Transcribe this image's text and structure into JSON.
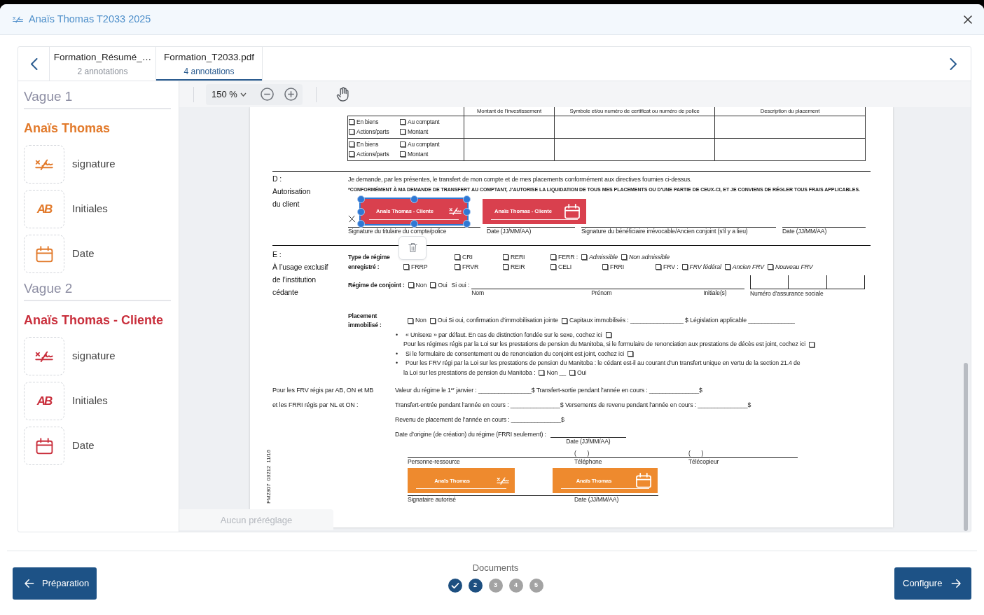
{
  "dialog": {
    "title": "Anaïs Thomas T2033 2025"
  },
  "document_tabs": [
    {
      "name": "Formation_Résumé_…",
      "count": "2 annotations",
      "selected": false
    },
    {
      "name": "Formation_T2033.pdf",
      "count": "4 annotations",
      "selected": true
    }
  ],
  "sidebar": {
    "waves": [
      {
        "title": "Vague 1",
        "signers": [
          {
            "name": "Anaïs Thomas",
            "color": "#e27a2b",
            "fields": [
              {
                "kind": "signature",
                "label": "signature"
              },
              {
                "kind": "initials",
                "glyph": "AB",
                "label": "Initiales"
              },
              {
                "kind": "date",
                "label": "Date"
              }
            ]
          }
        ]
      },
      {
        "title": "Vague 2",
        "signers": [
          {
            "name": "Anaïs Thomas - Cliente",
            "color": "#c92f3c",
            "fields": [
              {
                "kind": "signature",
                "label": "signature"
              },
              {
                "kind": "initials",
                "glyph": "AB",
                "label": "Initiales"
              },
              {
                "kind": "date",
                "label": "Date"
              }
            ]
          }
        ]
      }
    ]
  },
  "viewer": {
    "zoom": "150 %",
    "preset": {
      "placeholder": "Aucun préréglage"
    }
  },
  "document": {
    "table": {
      "columns": [
        "Montant de l’investissement",
        "Symbole et/ou numéro de certificat ou numéro de police",
        "Description du placement"
      ],
      "rows": [
        {
          "choices": [
            {
              "label": "En biens",
              "checked": false
            },
            {
              "label": "Au comptant",
              "checked": false
            },
            {
              "label": "Actions/parts",
              "checked": false
            },
            {
              "label": "Montant",
              "checked": false
            }
          ]
        },
        {
          "choices": [
            {
              "label": "En biens",
              "checked": false
            },
            {
              "label": "Au comptant",
              "checked": false
            },
            {
              "label": "Actions/parts",
              "checked": false
            },
            {
              "label": "Montant",
              "checked": false
            }
          ]
        }
      ]
    },
    "section_d": {
      "letter": "D :",
      "title_lines": [
        "Autorisation",
        "du client"
      ],
      "statement": "Je demande, par les présentes, le transfert de mon compte et de mes placements conformément aux directives fournies ci-dessus.",
      "notice": "*CONFORMÉMENT À MA DEMANDE DE TRANSFERT AU COMPTANT, J’AUTORISE LA LIQUIDATION DE TOUS MES PLACEMENTS OU D’UNE PARTIE DE CEUX-CI, ET JE CONVIENS DE RÉGLER TOUS FRAIS APPLICABLES.",
      "annotations": [
        {
          "signer": "Anaïs Thomas - Cliente",
          "kind": "signature",
          "color": "#d9404e",
          "selected": true
        },
        {
          "signer": "Anaïs Thomas - Cliente",
          "kind": "date",
          "color": "#d9404e",
          "selected": false
        }
      ],
      "signature_lines": [
        "Signature du titulaire du compte/police",
        "Date (JJ/MM/AA)",
        "Signature du bénéficiaire irrévocable/Ancien conjoint (s’il y a lieu)",
        "Date (JJ/MM/AA)"
      ]
    },
    "section_e": {
      "letter": "E :",
      "title_lines": [
        "À l’usage exclusif",
        "de l’institution",
        "cédante"
      ],
      "regime": {
        "label_lines": [
          "Type de régime",
          "enregistré :"
        ],
        "rows": [
          [
            "",
            [
              {
                "text": "CRI",
                "checked": false
              }
            ],
            [
              {
                "text": "RERI",
                "checked": false
              }
            ],
            [
              {
                "text": "FERR :",
                "checked": false
              },
              {
                "text": "Admissible",
                "italic": true,
                "checked": false
              },
              {
                "text": "Non admissible",
                "italic": true,
                "checked": false
              }
            ]
          ],
          [
            [
              {
                "text": "FRRP",
                "checked": false
              }
            ],
            [
              {
                "text": "FRVR",
                "checked": false
              }
            ],
            [
              {
                "text": "REIR",
                "checked": false
              }
            ],
            [
              {
                "text": "CELI",
                "checked": false
              }
            ],
            [
              {
                "text": "FRRI",
                "checked": false
              }
            ],
            [
              {
                "text": "FRV :",
                "checked": false
              },
              {
                "text": "FRV fédéral",
                "italic": true,
                "checked": false
              },
              {
                "text": "Ancien FRV",
                "italic": true,
                "checked": false
              },
              {
                "text": "Nouveau FRV",
                "italic": true,
                "checked": false
              }
            ]
          ]
        ]
      },
      "spouse": {
        "label": "Régime de conjoint :",
        "options": [
          {
            "label": "Non",
            "checked": false
          },
          {
            "label": "Oui",
            "checked": false
          }
        ],
        "if_yes": "Si oui :",
        "name_captions": [
          "Nom",
          "Prénom",
          "Initiale(s)"
        ],
        "sin_caption": "Numéro d’assurance sociale"
      },
      "locked_in": {
        "label_lines": [
          "Placement",
          "immobilisé :"
        ],
        "runs": [
          {
            "kind": "box",
            "checked": false
          },
          {
            "kind": "text",
            "text": "Non"
          },
          {
            "kind": "box",
            "checked": false
          },
          {
            "kind": "text",
            "text": "Oui Si oui, confirmation d’immobilisation jointe"
          },
          {
            "kind": "box",
            "checked": false
          },
          {
            "kind": "text",
            "text": "Capitaux immobilisés : ________________ $ Législation applicable ______________"
          }
        ]
      },
      "notes": [
        {
          "bullet": "•",
          "runs": [
            {
              "kind": "text",
              "text": "« Unisexe » par défaut. En cas de distinction fondée sur le sexe, cochez ici"
            },
            {
              "kind": "box",
              "checked": false
            }
          ]
        },
        {
          "runs": [
            {
              "kind": "text",
              "text": "Pour les régimes régis par la Loi sur les prestations de pension du Manitoba, si le formulaire de renonciation aux prestations de décès est joint, cochez ici"
            },
            {
              "kind": "box",
              "checked": false
            }
          ]
        },
        {
          "bullet": "•",
          "runs": [
            {
              "kind": "text",
              "text": "Si le formulaire de consentement ou de renonciation du conjoint est joint, cochez ici"
            },
            {
              "kind": "box",
              "checked": false
            }
          ]
        },
        {
          "bullet": "•",
          "runs": [
            {
              "kind": "text",
              "text": "Pour les FRV régi par la Loi sur les prestations de pension du Manitoba : le cédant est-il au courant d’un transfert unique en vertu de la section 21.4 de"
            }
          ]
        },
        {
          "runs": [
            {
              "kind": "text",
              "text": "la Loi sur les prestations de pension du Manitoba :"
            },
            {
              "kind": "box",
              "checked": false
            },
            {
              "kind": "text",
              "text": "Non __"
            },
            {
              "kind": "box",
              "checked": false
            },
            {
              "kind": "text",
              "text": "Oui"
            }
          ]
        }
      ]
    },
    "balances": {
      "label_lines": [
        "Pour les FRV régis par AB, ON et MB",
        "et les FRRI régis par NL et ON :"
      ],
      "lines": [
        "Valeur du régime le 1$^{er}$ janvier : ________________$ Transfert-sortie pendant l’année en cours : _______________$",
        "Transfert-entrée pendant l’année en cours : _______________$ Versements de revenu pendant l’année en cours : _______________$",
        "Revenu de placement de l’année en cours : _______________$"
      ],
      "origin": {
        "text": "Date d’origine (de création) du régime (FRRI seulement) :",
        "caption": "Date (JJ/MM/AA)"
      }
    },
    "contact": {
      "top_fields": [
        {
          "label": "Personne-ressource"
        },
        {
          "prefix": "(       )",
          "label": "Téléphone"
        },
        {
          "prefix": "(       )",
          "label": "Télécopieur"
        }
      ],
      "annotations": [
        {
          "signer": "Anaïs Thomas",
          "kind": "signature",
          "color": "#ee8a2e",
          "selected": false
        },
        {
          "signer": "Anaïs Thomas",
          "kind": "date",
          "color": "#ee8a2e",
          "selected": false
        }
      ],
      "bottom_fields": [
        {
          "label": "Signataire autorisé"
        },
        {
          "label": "Date (JJ/MM/AA)"
        }
      ]
    },
    "form_code": "FM2307  03212  11/16"
  },
  "footer": {
    "back": "Préparation",
    "label": "Documents",
    "steps": [
      {
        "completed": true,
        "current": false
      },
      {
        "label": "2",
        "completed": false,
        "current": true
      },
      {
        "label": "3",
        "completed": false,
        "current": false
      },
      {
        "label": "4",
        "completed": false,
        "current": false
      },
      {
        "label": "5",
        "completed": false,
        "current": false
      }
    ],
    "next": "Configure"
  }
}
